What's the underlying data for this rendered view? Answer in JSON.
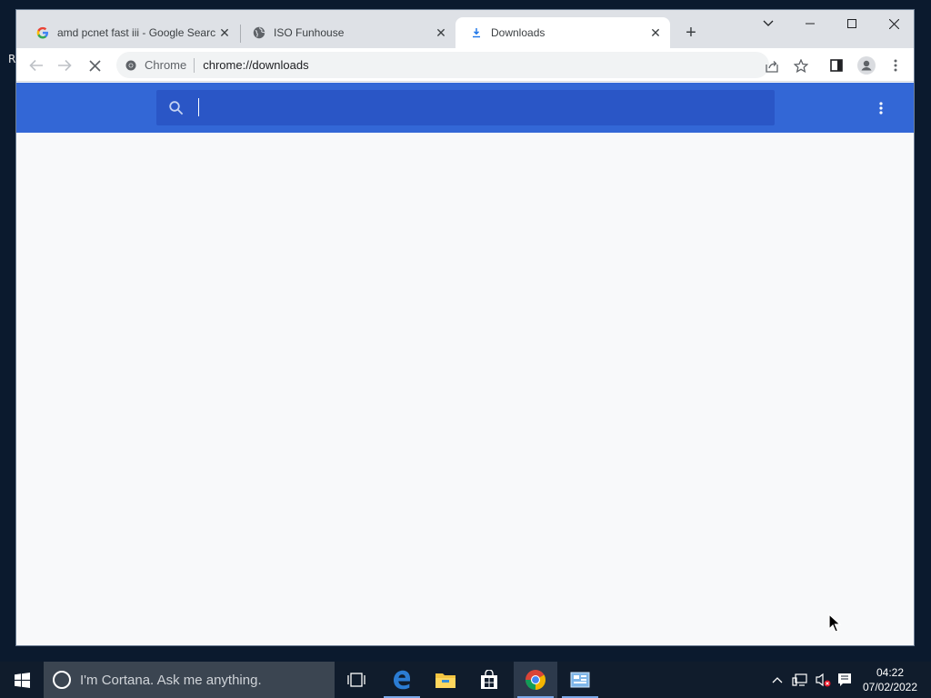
{
  "desktop": {
    "edge_text": "R"
  },
  "tabs": [
    {
      "title": "amd pcnet fast iii - Google Searc",
      "icon": "google-icon"
    },
    {
      "title": "ISO Funhouse",
      "icon": "globe-icon"
    },
    {
      "title": "Downloads",
      "icon": "download-icon",
      "active": true
    }
  ],
  "toolbar": {
    "omnibox_chip": "Chrome",
    "url": "chrome://downloads"
  },
  "downloads": {
    "search_value": "",
    "header_color": "#3367d6"
  },
  "taskbar": {
    "cortana_placeholder": "I'm Cortana. Ask me anything.",
    "time": "04:22",
    "date": "07/02/2022"
  },
  "colors": {
    "accent": "#3367d6",
    "taskbar": "#101c2c"
  }
}
